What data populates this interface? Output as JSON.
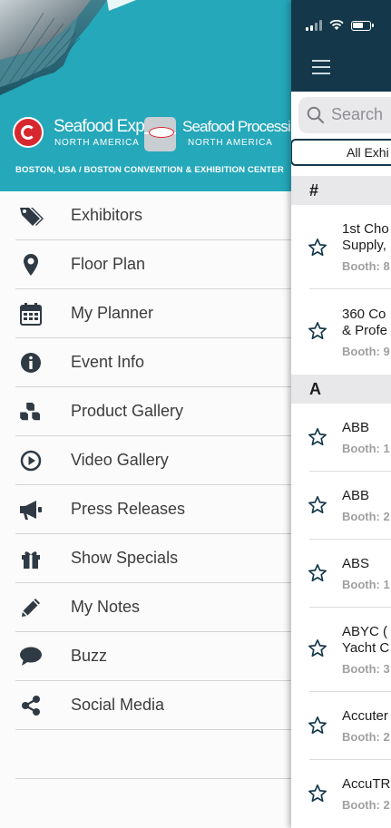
{
  "drawer": {
    "logo_expo": {
      "title": "Seafood Expo",
      "subtitle": "NORTH AMERICA"
    },
    "logo_processing": {
      "title": "Seafood Processing",
      "subtitle": "NORTH AMERICA"
    },
    "venue": "BOSTON, USA / BOSTON CONVENTION & EXHIBITION CENTER",
    "items": [
      {
        "label": "Exhibitors",
        "icon": "tags-icon"
      },
      {
        "label": "Floor Plan",
        "icon": "map-marker-icon"
      },
      {
        "label": "My Planner",
        "icon": "calendar-icon"
      },
      {
        "label": "Event Info",
        "icon": "info-circle-icon"
      },
      {
        "label": "Product Gallery",
        "icon": "cubes-icon"
      },
      {
        "label": "Video Gallery",
        "icon": "play-circle-icon"
      },
      {
        "label": "Press Releases",
        "icon": "megaphone-icon"
      },
      {
        "label": "Show Specials",
        "icon": "gift-icon"
      },
      {
        "label": "My Notes",
        "icon": "pencil-icon"
      },
      {
        "label": "Buzz",
        "icon": "speech-bubble-icon"
      },
      {
        "label": "Social Media",
        "icon": "share-icon"
      }
    ]
  },
  "main": {
    "search_placeholder": "Search",
    "segment_label": "All Exhi",
    "sections": [
      {
        "header": "#",
        "rows": [
          {
            "name_lines": [
              "1st Cho",
              "Supply,"
            ],
            "booth": "Booth: 8"
          },
          {
            "name_lines": [
              "360 Co",
              "& Profe"
            ],
            "booth": "Booth: 9"
          }
        ]
      },
      {
        "header": "A",
        "rows": [
          {
            "name_lines": [
              "ABB"
            ],
            "booth": "Booth: 1"
          },
          {
            "name_lines": [
              "ABB"
            ],
            "booth": "Booth: 2"
          },
          {
            "name_lines": [
              "ABS"
            ],
            "booth": "Booth: 1"
          },
          {
            "name_lines": [
              "ABYC (",
              "Yacht C"
            ],
            "booth": "Booth: 3"
          },
          {
            "name_lines": [
              "Accuter"
            ],
            "booth": "Booth: 2"
          },
          {
            "name_lines": [
              "AccuTR"
            ],
            "booth": "Booth: 2"
          }
        ]
      }
    ]
  },
  "colors": {
    "header_teal": "#25a8ba",
    "navy": "#14384a",
    "logo_red": "#d7282f",
    "icon_dark": "#2f3a44"
  }
}
